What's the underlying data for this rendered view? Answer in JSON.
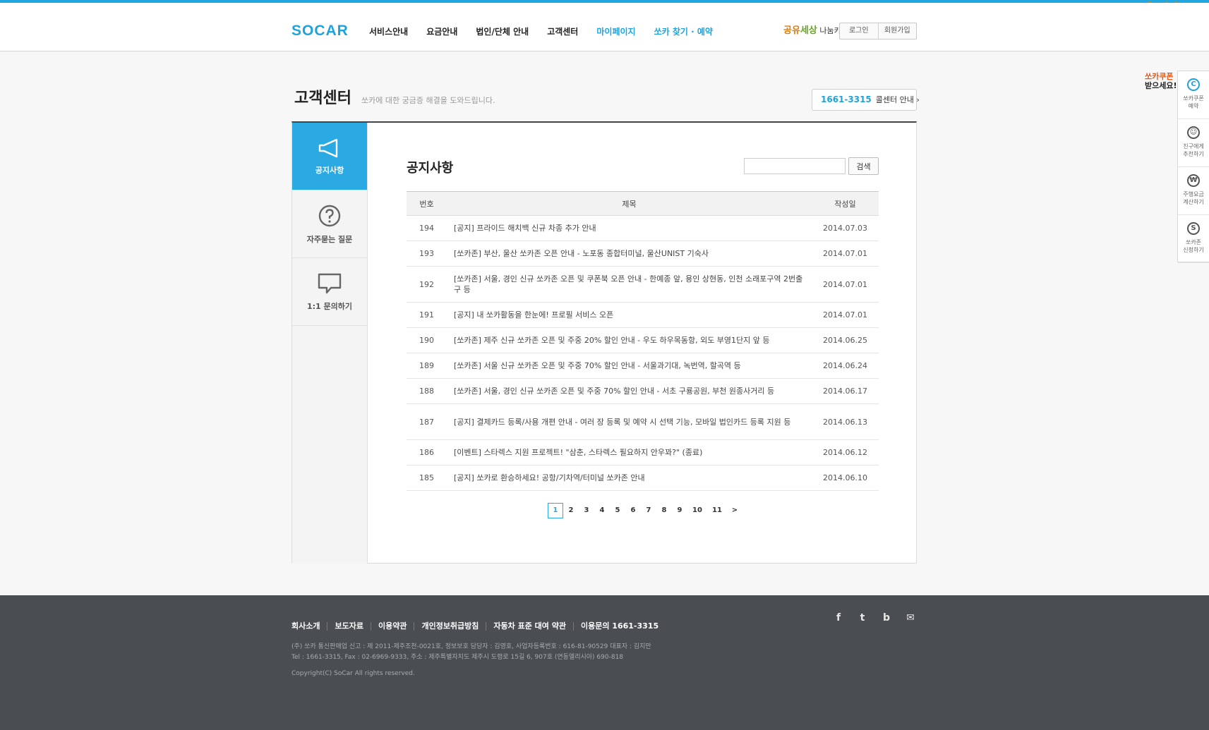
{
  "watermark": "Cnwebshow.com",
  "header": {
    "logo": "SOCAR",
    "nav": [
      "서비스안내",
      "요금안내",
      "법인/단체 안내",
      "고객센터",
      "마이페이지",
      "쏘카 찾기 · 예약"
    ],
    "share": {
      "part1": "공유",
      "part2": "세상",
      "part3": "나눔카"
    },
    "login": "로그인",
    "signup": "회원가입"
  },
  "page": {
    "title": "고객센터",
    "desc": "쏘카에 대한 궁금증 해결을 도와드립니다.",
    "call_number": "1661-3315",
    "call_label": "콜센터 안내 ›"
  },
  "lnb": {
    "items": [
      "공지사항",
      "자주묻는 질문",
      "1:1 문의하기"
    ]
  },
  "notice": {
    "title": "공지사항",
    "search_button": "검색",
    "columns": [
      "번호",
      "제목",
      "작성일"
    ],
    "rows": [
      {
        "no": "194",
        "title": "[공지] 프라이드 해치백 신규 차종 추가 안내",
        "date": "2014.07.03"
      },
      {
        "no": "193",
        "title": "[쏘카존] 부산, 울산 쏘카존 오픈 안내 - 노포동 종합터미널, 울산UNIST 기숙사",
        "date": "2014.07.01"
      },
      {
        "no": "192",
        "title": "[쏘카존] 서울, 경인 신규 쏘카존 오픈 및 쿠폰북 오픈 안내 - 한예종 앞, 용인 상현동, 인천 소래포구역 2번출구 등",
        "date": "2014.07.01"
      },
      {
        "no": "191",
        "title": "[공지] 내 쏘카활동을 한눈에! 프로필 서비스 오픈",
        "date": "2014.07.01"
      },
      {
        "no": "190",
        "title": "[쏘카존] 제주 신규 쏘카존 오픈 및 주중 20% 할인 안내 - 우도 하우목동항, 외도 부영1단지 앞 등",
        "date": "2014.06.25"
      },
      {
        "no": "189",
        "title": "[쏘카존] 서울 신규 쏘카존 오픈 및 주중 70% 할인 안내 - 서울과기대, 녹번역, 할곡역 등",
        "date": "2014.06.24"
      },
      {
        "no": "188",
        "title": "[쏘카존] 서울, 경인 신규 쏘카존 오픈 및 주중 70% 할인 안내 - 서초 구룡공원, 부천 원종사거리 등",
        "date": "2014.06.17"
      },
      {
        "no": "187",
        "title": "[공지] 결제카드 등록/사용 개편 안내 - 여러 장 등록 및 예약 시 선택 기능, 모바일 법인카드 등록 지원 등",
        "date": "2014.06.13"
      },
      {
        "no": "186",
        "title": "[이벤트] 스타렉스 지원 프로젝트! \"삼춘, 스타렉스 필요하지 안우꽈?\" (종료)",
        "date": "2014.06.12"
      },
      {
        "no": "185",
        "title": "[공지] 쏘카로 환승하세요! 공항/기차역/터미널 쏘카존 안내",
        "date": "2014.06.10"
      }
    ],
    "pages": [
      "1",
      "2",
      "3",
      "4",
      "5",
      "6",
      "7",
      "8",
      "9",
      "10",
      "11",
      ">"
    ],
    "current_page": "1"
  },
  "quick": {
    "note_line1": "쏘카쿠폰",
    "note_line2": "받으세요!",
    "items": [
      {
        "icon": "C",
        "label1": "쏘카쿠폰",
        "label2": "예약"
      },
      {
        "icon": "☺",
        "label1": "친구에게",
        "label2": "추천하기"
      },
      {
        "icon": "₩",
        "label1": "주행요금",
        "label2": "계산하기"
      },
      {
        "icon": "S",
        "label1": "쏘카존",
        "label2": "신청하기"
      }
    ]
  },
  "footer": {
    "links": [
      "회사소개",
      "보도자료",
      "이용약관",
      "개인정보취급방침",
      "자동차 표준 대여 약관",
      "이용문의 1661-3315"
    ],
    "info1": "(주) 쏘카 통신판매업 신고 : 제 2011-제주조천-0021호, 정보보호 담당자 : 김영호, 사업자등록번호 : 616-81-90529  대표자 : 김지만",
    "info2": "Tel : 1661-3315, Fax : 02-6969-9333, 주소 : 제주특별자치도 제주시 도령로 15길 6, 907호 (연동엘리시아) 690-818",
    "copyright": "Copyright(C) SoCar All rights reserved.",
    "sns": [
      "f",
      "t",
      "b",
      "✉"
    ]
  }
}
